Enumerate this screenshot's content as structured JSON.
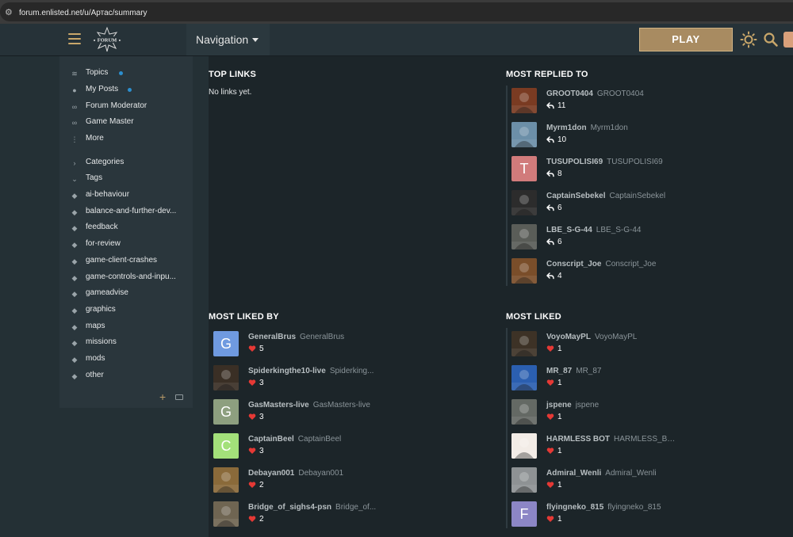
{
  "browser": {
    "url": "forum.enlisted.net/u/Артас/summary"
  },
  "header": {
    "logo_text": "FORUM",
    "navigation_label": "Navigation",
    "play_label": "PLAY"
  },
  "sidebar": {
    "items": [
      {
        "label": "Topics",
        "icon": "topics-icon",
        "dot": true
      },
      {
        "label": "My Posts",
        "icon": "user-icon",
        "dot": true
      },
      {
        "label": "Forum Moderator",
        "icon": "link-icon",
        "dot": false
      },
      {
        "label": "Game Master",
        "icon": "link-icon",
        "dot": false
      },
      {
        "label": "More",
        "icon": "more-vertical-icon",
        "dot": false
      }
    ],
    "categories_label": "Categories",
    "tags_label": "Tags",
    "tags": [
      "ai-behaviour",
      "balance-and-further-dev...",
      "feedback",
      "for-review",
      "game-client-crashes",
      "game-controls-and-inpu...",
      "gameadvise",
      "graphics",
      "maps",
      "missions",
      "mods",
      "other"
    ]
  },
  "top_links": {
    "title": "TOP LINKS",
    "empty_text": "No links yet."
  },
  "most_replied_to": {
    "title": "MOST REPLIED TO",
    "users": [
      {
        "username": "GROOT0404",
        "name": "GROOT0404",
        "count": "11",
        "avatar": "img",
        "color": "#7a3b22"
      },
      {
        "username": "Myrm1don",
        "name": "Myrm1don",
        "count": "10",
        "avatar": "img",
        "color": "#6c8fa8"
      },
      {
        "username": "TUSUPOLISI69",
        "name": "TUSUPOLISI69",
        "count": "8",
        "avatar": "T",
        "color": "#d17b7b"
      },
      {
        "username": "CaptainSebekel",
        "name": "CaptainSebekel",
        "count": "6",
        "avatar": "img",
        "color": "#2c2c2c"
      },
      {
        "username": "LBE_S-G-44",
        "name": "LBE_S-G-44",
        "count": "6",
        "avatar": "img",
        "color": "#5a5d58"
      },
      {
        "username": "Conscript_Joe",
        "name": "Conscript_Joe",
        "count": "4",
        "avatar": "img",
        "color": "#7a4e2a"
      }
    ]
  },
  "most_liked_by": {
    "title": "MOST LIKED BY",
    "users": [
      {
        "username": "GeneralBrus",
        "name": "GeneralBrus",
        "count": "5",
        "avatar": "G",
        "color": "#6f9ae0"
      },
      {
        "username": "Spiderkingthe10-live",
        "name": "Spiderking...",
        "count": "3",
        "avatar": "img",
        "color": "#3a2f25"
      },
      {
        "username": "GasMasters-live",
        "name": "GasMasters-live",
        "count": "3",
        "avatar": "G",
        "color": "#8d9f7f"
      },
      {
        "username": "CaptainBeel",
        "name": "CaptainBeel",
        "count": "3",
        "avatar": "C",
        "color": "#a3e07a"
      },
      {
        "username": "Debayan001",
        "name": "Debayan001",
        "count": "2",
        "avatar": "img",
        "color": "#8a6a3a"
      },
      {
        "username": "Bridge_of_sighs4-psn",
        "name": "Bridge_of...",
        "count": "2",
        "avatar": "img",
        "color": "#6f6552"
      }
    ]
  },
  "most_liked": {
    "title": "MOST LIKED",
    "users": [
      {
        "username": "VoyoMayPL",
        "name": "VoyoMayPL",
        "count": "1",
        "avatar": "img",
        "color": "#3d3226"
      },
      {
        "username": "MR_87",
        "name": "MR_87",
        "count": "1",
        "avatar": "img",
        "color": "#2b5fb0"
      },
      {
        "username": "jspene",
        "name": "jspene",
        "count": "1",
        "avatar": "img",
        "color": "#646964"
      },
      {
        "username": "HARMLESS BOT",
        "name": "HARMLESS_BOT",
        "count": "1",
        "avatar": "img",
        "color": "#f2ece6"
      },
      {
        "username": "Admiral_Wenli",
        "name": "Admiral_Wenli",
        "count": "1",
        "avatar": "img",
        "color": "#8e9294"
      },
      {
        "username": "flyingneko_815",
        "name": "flyingneko_815",
        "count": "1",
        "avatar": "F",
        "color": "#8c86c6"
      }
    ]
  },
  "colors": {
    "accent": "#a88b61",
    "heart": "#e53935",
    "dot": "#2c8fcf"
  }
}
